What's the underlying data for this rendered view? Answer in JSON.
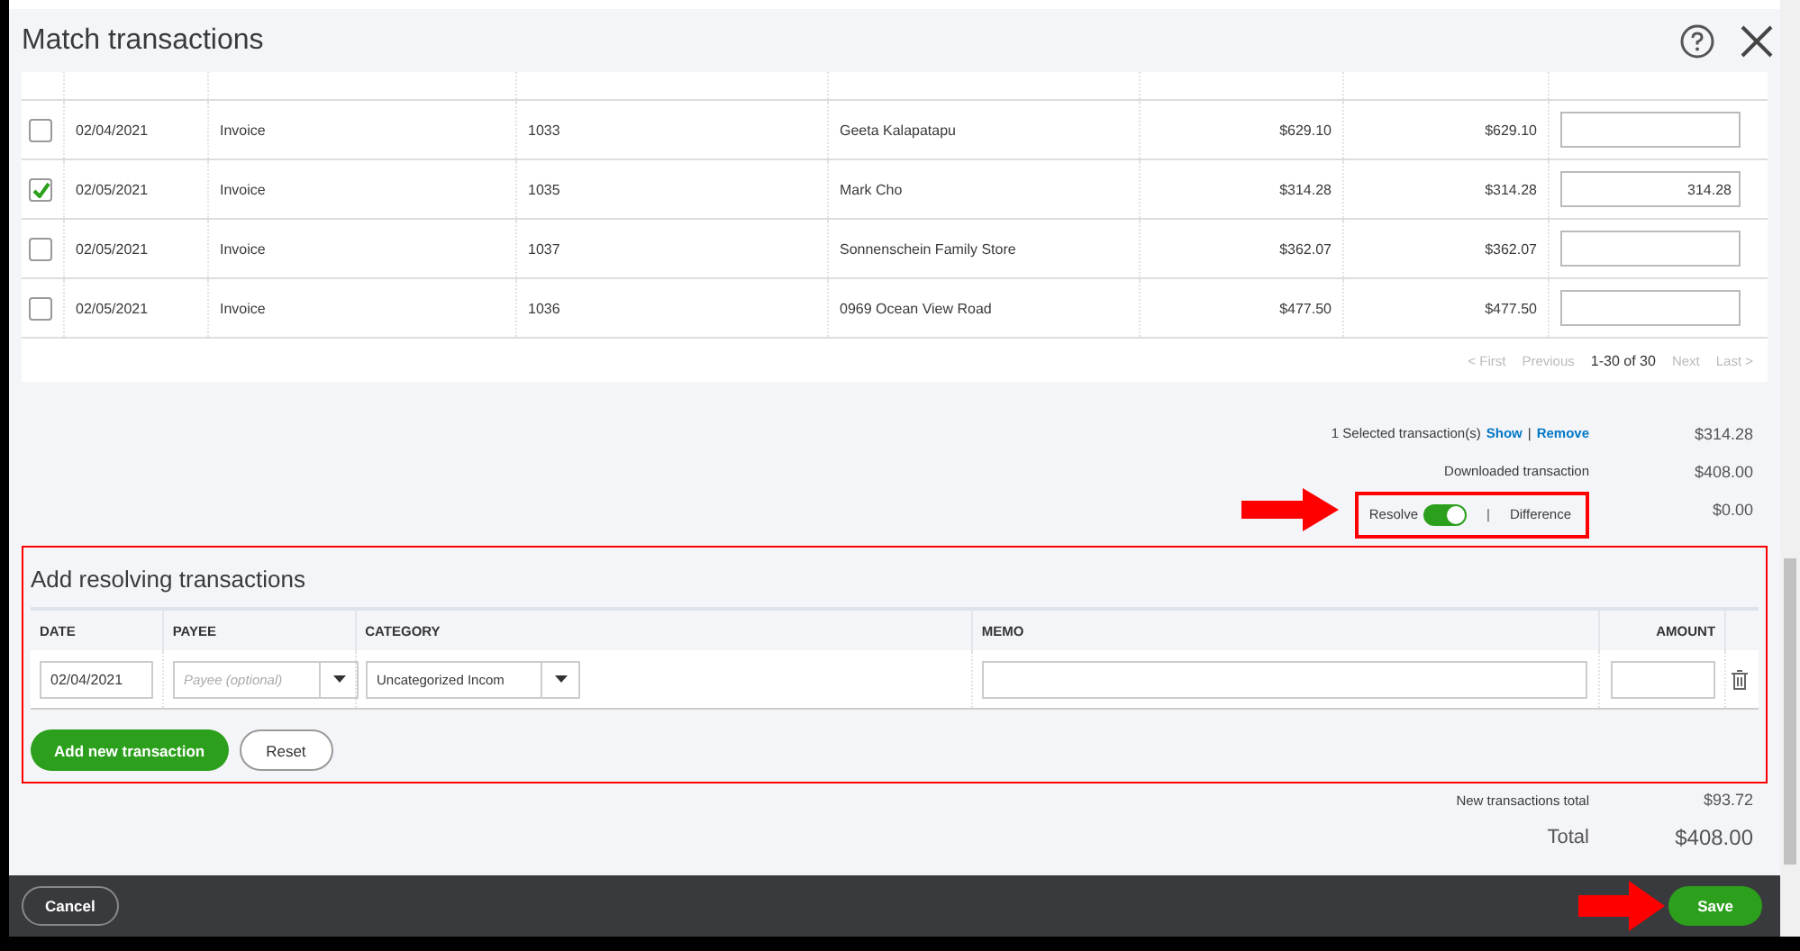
{
  "window": {
    "title": "Match transactions"
  },
  "table": {
    "rows": [
      {
        "selected": false,
        "date": "02/04/2021",
        "type": "Invoice",
        "number": "1033",
        "payee": "Geeta Kalapatapu",
        "column_6": "$629.10",
        "column_7": "$629.10"
      },
      {
        "selected": true,
        "date": "02/05/2021",
        "type": "Invoice",
        "number": "1035",
        "payee": "Mark Cho",
        "column_6": "$314.28",
        "column_7": "$314.28",
        "payment": "314.28"
      },
      {
        "selected": false,
        "date": "02/05/2021",
        "type": "Invoice",
        "number": "1037",
        "payee": "Sonnenschein Family Store",
        "column_6": "$362.07",
        "column_7": "$362.07"
      },
      {
        "selected": false,
        "date": "02/05/2021",
        "type": "Invoice",
        "number": "1036",
        "payee": "0969 Ocean View Road",
        "column_6": "$477.50",
        "column_7": "$477.50"
      }
    ],
    "pagination": [
      {
        "label": "< First",
        "kind": "link",
        "disabled": true
      },
      {
        "label": "Previous",
        "kind": "link",
        "disabled": true
      },
      {
        "label": "1-30 of 30",
        "kind": "range",
        "disabled": false
      },
      {
        "label": "Next",
        "kind": "link",
        "disabled": true
      },
      {
        "label": "Last >",
        "kind": "link",
        "disabled": true
      }
    ]
  },
  "summary": {
    "selected_label": "1 Selected transaction(s)",
    "show_link": "Show",
    "separator": "|",
    "remove_link": "Remove",
    "selected_amount": "$314.28",
    "downloaded_label": "Downloaded transaction",
    "downloaded_amount": "$408.00",
    "resolve": {
      "label": "Resolve",
      "on": true,
      "separator": "|",
      "difference_label": "Difference",
      "amount": "$0.00"
    }
  },
  "resolving": {
    "title": "Add resolving transactions",
    "columns": [
      "DATE",
      "PAYEE",
      "CATEGORY",
      "MEMO",
      "AMOUNT"
    ],
    "entry": {
      "date": "02/04/2021",
      "payee_placeholder": "Payee (optional)",
      "category": "Uncategorized Incom"
    },
    "add_button": "Add new transaction",
    "reset_button": "Reset"
  },
  "totals": {
    "new_label": "New transactions total",
    "new_amount": "$93.72",
    "total_label": "Total",
    "total_amount": "$408.00"
  },
  "footer": {
    "cancel": "Cancel",
    "save": "Save"
  }
}
